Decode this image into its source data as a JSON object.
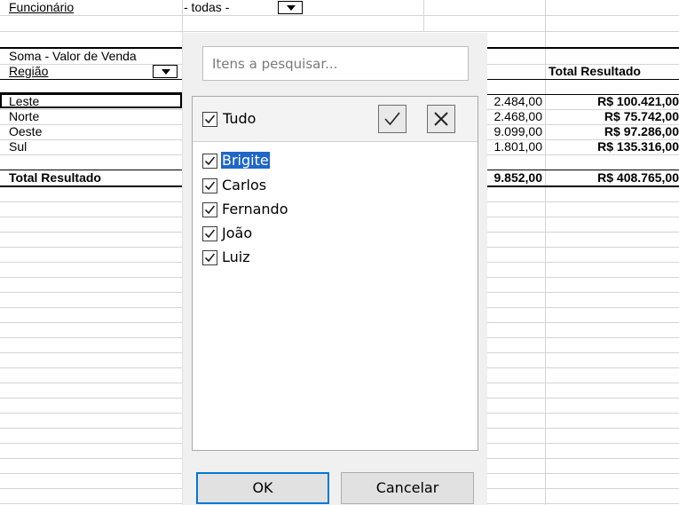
{
  "filter": {
    "field_label": "Funcionário",
    "value": "- todas -"
  },
  "pivot": {
    "data_label": "Soma - Valor de Venda",
    "row_field_label": "Região",
    "col_total_header": "Total Resultado",
    "rows": [
      {
        "label": "Leste",
        "partial": "2.484,00",
        "total": "R$ 100.421,00"
      },
      {
        "label": "Norte",
        "partial": "2.468,00",
        "total": "R$ 75.742,00"
      },
      {
        "label": "Oeste",
        "partial": "9.099,00",
        "total": "R$ 97.286,00"
      },
      {
        "label": "Sul",
        "partial": "1.801,00",
        "total": "R$ 135.316,00"
      }
    ],
    "grand_total": {
      "label": "Total Resultado",
      "partial": "9.852,00",
      "total": "R$ 408.765,00"
    }
  },
  "popup": {
    "search_placeholder": "Itens a pesquisar...",
    "select_all_label": "Tudo",
    "items": [
      {
        "label": "Brigite",
        "checked": true,
        "selected": true
      },
      {
        "label": "Carlos",
        "checked": true
      },
      {
        "label": "Fernando",
        "checked": true
      },
      {
        "label": "João",
        "checked": true
      },
      {
        "label": "Luiz",
        "checked": true
      }
    ],
    "ok_label": "OK",
    "cancel_label": "Cancelar"
  },
  "icons": {
    "check": "check-icon",
    "close": "close-icon",
    "dropdown": "triangle-down-icon"
  },
  "colors": {
    "selection": "#1e66c9",
    "ok_border": "#0078d7"
  }
}
